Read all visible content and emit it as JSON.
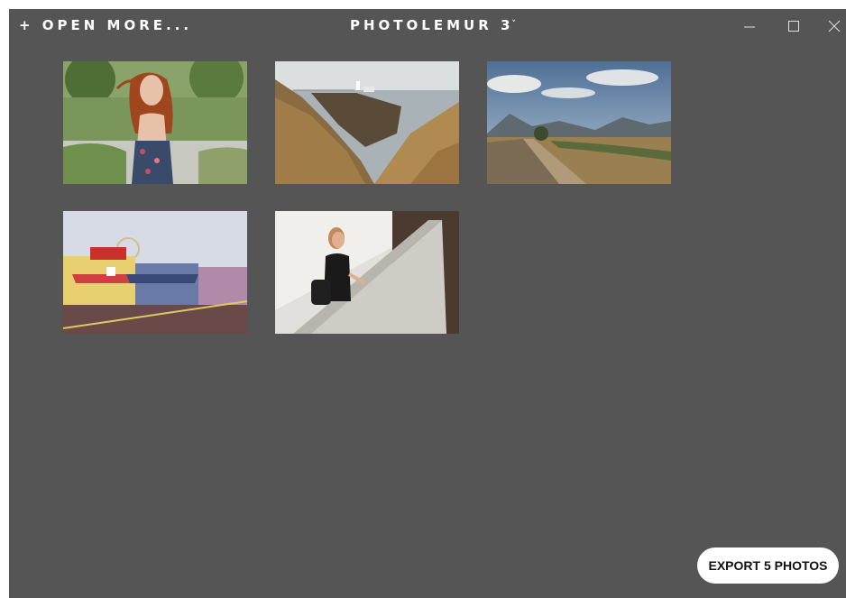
{
  "toolbar": {
    "open_more_label": "+ OPEN MORE...",
    "app_title": "PHOTOLEMUR 3",
    "title_menu_caret": "˅"
  },
  "window_controls": {
    "minimize_icon": "minimize-icon",
    "maximize_icon": "maximize-icon",
    "close_icon": "close-icon"
  },
  "photos": [
    {
      "subject": "woman-red-hair-field"
    },
    {
      "subject": "coastal-cliffs-lighthouse"
    },
    {
      "subject": "desert-road-mountains"
    },
    {
      "subject": "boardwalk-shops-ferris-wheel"
    },
    {
      "subject": "woman-concrete-wall"
    }
  ],
  "export": {
    "label": "EXPORT 5 PHOTOS"
  },
  "colors": {
    "background": "#555555",
    "text": "#ffffff",
    "button_bg": "#ffffff",
    "button_text": "#111111"
  }
}
